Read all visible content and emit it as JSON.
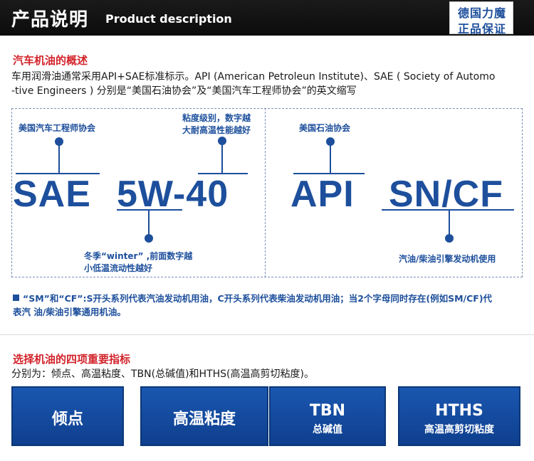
{
  "header": {
    "title_cn": "产品说明",
    "title_en": "Product description",
    "brand_line1": "德国力魔",
    "brand_line2": "正品保证"
  },
  "overview": {
    "title": "汽车机油的概述",
    "line1": "车用润滑油通常采用API+SAE标准标示。API (American Petroleun Institute)、SAE ( Society of Automo",
    "line2": "-tive Engineers ) 分别是“美国石油协会”及“美国汽车工程师协会”的英文缩写"
  },
  "diagram": {
    "sae_callout": "美国汽车工程师协会",
    "viscosity_callout_1": "粘度级别，数字越",
    "viscosity_callout_2": "大耐高温性能越好",
    "api_callout": "美国石油协会",
    "sae_text": "SAE",
    "grade_text": "5W-40",
    "api_text": "API",
    "sn_text": "SN/CF",
    "winter_callout_1": "冬季“winter” ,前面数字越",
    "winter_callout_2": "小低温流动性越好",
    "engine_callout": "汽油/柴油引擎发动机使用"
  },
  "note": {
    "line1": "“SM”和“CF”:S开头系列代表汽油发动机用油，C开头系列代表柴油发动机用油；当2个字母同时存在(例如SM/CF)代",
    "line2": "表汽  油/柴油引擎通用机油。"
  },
  "indicators": {
    "title": "选择机油的四项重要指标",
    "subtitle": "分别为：倾点、高温粘度、TBN(总碱值)和HTHS(高温高剪切粘度)。",
    "items": [
      {
        "main": "倾点",
        "sub": ""
      },
      {
        "main": "高温粘度",
        "sub": ""
      },
      {
        "main": "TBN",
        "sub": "总碱值"
      },
      {
        "main": "HTHS",
        "sub": "高温高剪切粘度"
      }
    ]
  },
  "colors": {
    "brand_blue": "#1d4f9c",
    "heading_red": "#d2232a",
    "header_bg": "#111111"
  }
}
